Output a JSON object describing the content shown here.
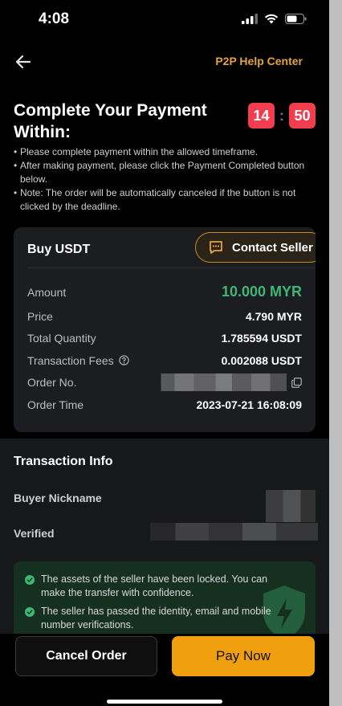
{
  "status_bar": {
    "time": "4:08"
  },
  "header": {
    "help_link": "P2P Help Center"
  },
  "payment": {
    "title": "Complete Your Payment Within:",
    "countdown": {
      "minutes": "14",
      "separator": ":",
      "seconds": "50"
    },
    "notes": [
      "Please complete payment within the allowed timeframe.",
      "After making payment, please click the Payment Completed button below.",
      "Note: The order will be automatically canceled if the button is not clicked by the deadline."
    ]
  },
  "order": {
    "title": "Buy USDT",
    "contact_seller": "Contact Seller",
    "rows": {
      "amount": {
        "label": "Amount",
        "value": "10.000 MYR"
      },
      "price": {
        "label": "Price",
        "value": "4.790 MYR"
      },
      "total_quantity": {
        "label": "Total Quantity",
        "value": "1.785594 USDT"
      },
      "fees": {
        "label": "Transaction Fees",
        "value": "0.002088 USDT"
      },
      "order_no": {
        "label": "Order No."
      },
      "order_time": {
        "label": "Order Time",
        "value": "2023-07-21 16:08:09"
      }
    }
  },
  "transaction_info": {
    "title": "Transaction Info",
    "buyer_nickname_label": "Buyer Nickname",
    "verified_label": "Verified",
    "security_notes": [
      "The assets of the seller have been locked. You can make the transfer with confidence.",
      "The seller has passed the identity, email and mobile number verifications."
    ]
  },
  "actions": {
    "cancel": "Cancel Order",
    "pay": "Pay Now"
  },
  "colors": {
    "accent": "#f0a00e",
    "countdown": "#f23d4f",
    "positive": "#3db774",
    "link": "#e3a33f"
  }
}
